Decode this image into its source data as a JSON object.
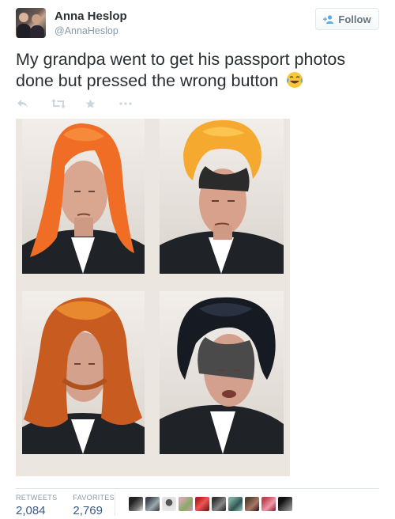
{
  "author": {
    "display_name": "Anna Heslop",
    "handle": "@AnnaHeslop"
  },
  "follow_button": {
    "label": "Follow"
  },
  "tweet": {
    "text": "My grandpa went to get his passport photos done but pressed the wrong button",
    "emoji": "face-with-tears-of-joy"
  },
  "actions": [
    "reply-icon",
    "retweet-icon",
    "favorite-icon",
    "more-icon"
  ],
  "stats": {
    "retweets_label": "RETWEETS",
    "retweets_value": "2,084",
    "favorites_label": "FAVORITES",
    "favorites_value": "2,769"
  },
  "favoriters_count_shown": 10,
  "colors": {
    "text": "#292f33",
    "muted": "#8899a6",
    "link_stat": "#3b5b87",
    "border": "#e1e8ed"
  }
}
